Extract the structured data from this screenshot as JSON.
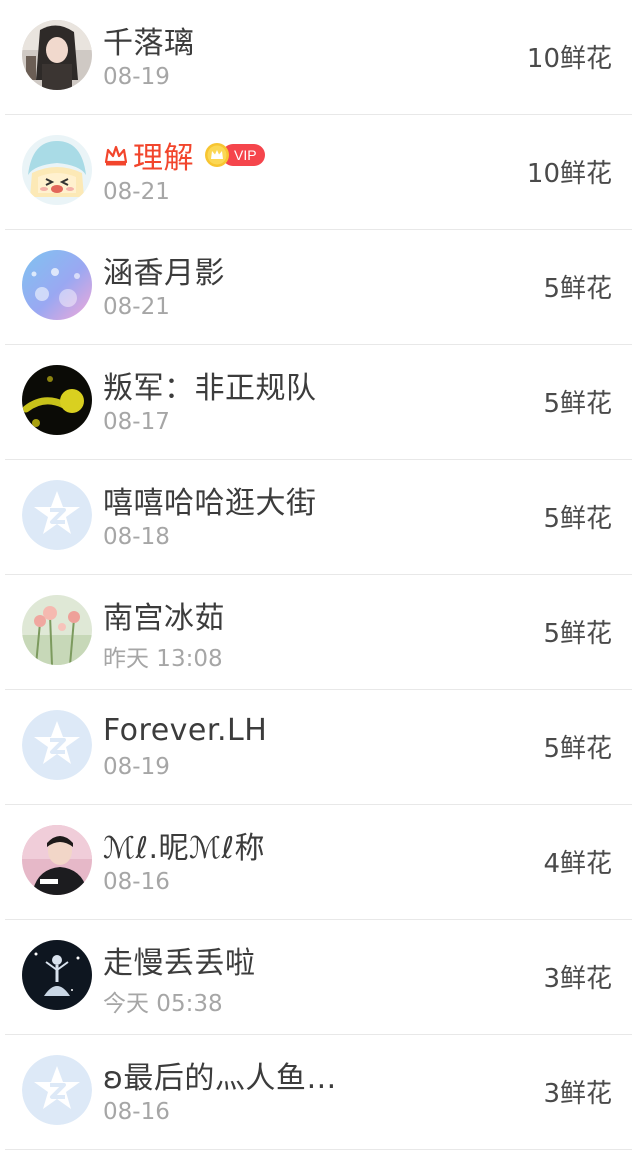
{
  "rows": [
    {
      "name": "千落璃",
      "time": "08-19",
      "flowers": "10鲜花",
      "avatar": "avatar-girl-dark-hair",
      "vip": false
    },
    {
      "name": "理解",
      "time": "08-21",
      "flowers": "10鲜花",
      "avatar": "avatar-anime-blue-hood",
      "vip": true,
      "vip_label": "VIP"
    },
    {
      "name": "涵香月影",
      "time": "08-21",
      "flowers": "5鲜花",
      "avatar": "avatar-blue-sparkle",
      "vip": false
    },
    {
      "name": "叛军：非正规队",
      "time": "08-17",
      "flowers": "5鲜花",
      "avatar": "avatar-black-yellow",
      "vip": false
    },
    {
      "name": "嘻嘻哈哈逛大街",
      "time": "08-18",
      "flowers": "5鲜花",
      "avatar": "avatar-default-z",
      "vip": false
    },
    {
      "name": "南宫冰茹",
      "time": "昨天 13:08",
      "flowers": "5鲜花",
      "avatar": "avatar-flowers",
      "vip": false
    },
    {
      "name": "Forever.LH",
      "time": "08-19",
      "flowers": "5鲜花",
      "avatar": "avatar-default-z",
      "vip": false
    },
    {
      "name": "ℳℓ.昵ℳℓ称",
      "time": "08-16",
      "flowers": "4鲜花",
      "avatar": "avatar-young-man",
      "vip": false
    },
    {
      "name": "走慢丢丢啦",
      "time": "今天 05:38",
      "flowers": "3鲜花",
      "avatar": "avatar-dancer-dark",
      "vip": false
    },
    {
      "name": "ʚ最后的灬人鱼…",
      "time": "08-16",
      "flowers": "3鲜花",
      "avatar": "avatar-default-z",
      "vip": false
    }
  ],
  "colors": {
    "name": "#3c3c3c",
    "vip_name": "#f2452c",
    "time": "#a6a6a6",
    "flowers": "#4a4a4a",
    "divider": "#e8e8e8",
    "vip_badge": "#f5454c"
  }
}
